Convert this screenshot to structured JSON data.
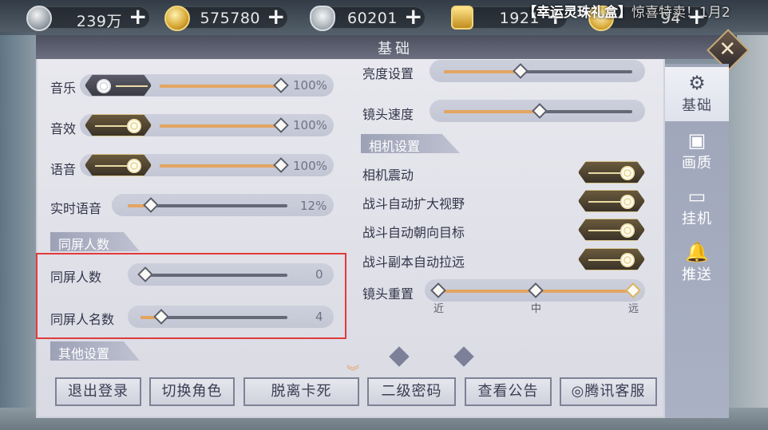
{
  "currencies": [
    {
      "value": "239万",
      "icon": "silver-coin-icon"
    },
    {
      "value": "575780",
      "icon": "gold-coin-icon"
    },
    {
      "value": "60201",
      "icon": "silver-ingot-icon"
    },
    {
      "value": "1921",
      "icon": "locked-gold-icon"
    },
    {
      "value": "94",
      "icon": "gold-ingot-icon"
    }
  ],
  "promo": {
    "bracket_open": "【",
    "name": "幸运灵珠礼盒",
    "bracket_close": "】",
    "tail": "惊喜特卖！1月2"
  },
  "window": {
    "title": "基础",
    "close": "✕"
  },
  "tabs": [
    {
      "label": "基础",
      "icon": "gear-icon",
      "glyph": "⚙"
    },
    {
      "label": "画质",
      "icon": "picture-icon",
      "glyph": "▣"
    },
    {
      "label": "挂机",
      "icon": "monitor-icon",
      "glyph": "▭"
    },
    {
      "label": "推送",
      "icon": "bell-icon",
      "glyph": "🔔"
    }
  ],
  "audio": {
    "music": {
      "label": "音乐",
      "pct": "100%",
      "value": 1.0,
      "enabled": false
    },
    "effects": {
      "label": "音效",
      "pct": "100%",
      "value": 1.0,
      "enabled": true
    },
    "voice": {
      "label": "语音",
      "pct": "100%",
      "value": 1.0,
      "enabled": true
    },
    "live_voice": {
      "label": "实时语音",
      "pct": "12%",
      "value": 0.12
    }
  },
  "players_section": {
    "title": "同屏人数",
    "count": {
      "label": "同屏人数",
      "value": "0",
      "fraction": 0.0
    },
    "names": {
      "label": "同屏人名数",
      "value": "4",
      "fraction": 0.1
    }
  },
  "other_section": {
    "title": "其他设置"
  },
  "display": {
    "brightness": {
      "label": "亮度设置",
      "fraction": 0.4
    },
    "camera_speed": {
      "label": "镜头速度",
      "fraction": 0.5
    }
  },
  "camera_section": {
    "title": "相机设置",
    "shake": {
      "label": "相机震动",
      "enabled": true
    },
    "auto_zoom": {
      "label": "战斗自动扩大视野",
      "enabled": true
    },
    "auto_face": {
      "label": "战斗自动朝向目标",
      "enabled": true
    },
    "dungeon_zoom": {
      "label": "战斗副本自动拉远",
      "enabled": true
    },
    "reset": {
      "label": "镜头重置",
      "ticks": [
        "近",
        "中",
        "远"
      ],
      "selected": "远"
    }
  },
  "buttons": [
    "退出登录",
    "切换角色",
    "脱离卡死",
    "二级密码",
    "查看公告",
    "腾讯客服"
  ],
  "colors": {
    "accent": "#e4a561",
    "highlight_box": "#e23a3a",
    "panel": "#e2e3ea"
  }
}
